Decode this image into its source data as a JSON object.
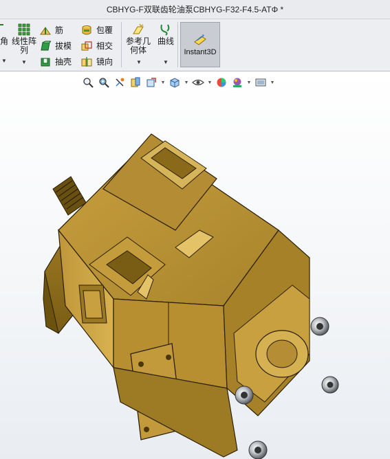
{
  "window": {
    "title": "CBHYG-F双联齿轮油泵CBHYG-F32-F4.5-ATΦ *"
  },
  "ribbon": {
    "corner_label": "角",
    "linear_pattern": {
      "line1": "线性阵",
      "line2": "列"
    },
    "rib": "筋",
    "draft": "拔模",
    "shell": "抽壳",
    "wrap": "包覆",
    "intersect": "相交",
    "mirror": "镜向",
    "reference_geometry": {
      "line1": "参考几",
      "line2": "何体"
    },
    "curves": "曲线",
    "instant3d": "Instant3D"
  },
  "headsup_toolbar": {
    "icons": [
      "zoom-to-fit-icon",
      "zoom-to-area-icon",
      "previous-view-icon",
      "section-view-icon",
      "dynamic-annotation-icon",
      "view-orientation-icon",
      "display-style-icon",
      "hide-show-items-icon",
      "edit-appearance-icon",
      "apply-scene-icon",
      "view-settings-icon"
    ]
  },
  "model": {
    "name": "gear-pump-model",
    "color": "#b8922f"
  }
}
